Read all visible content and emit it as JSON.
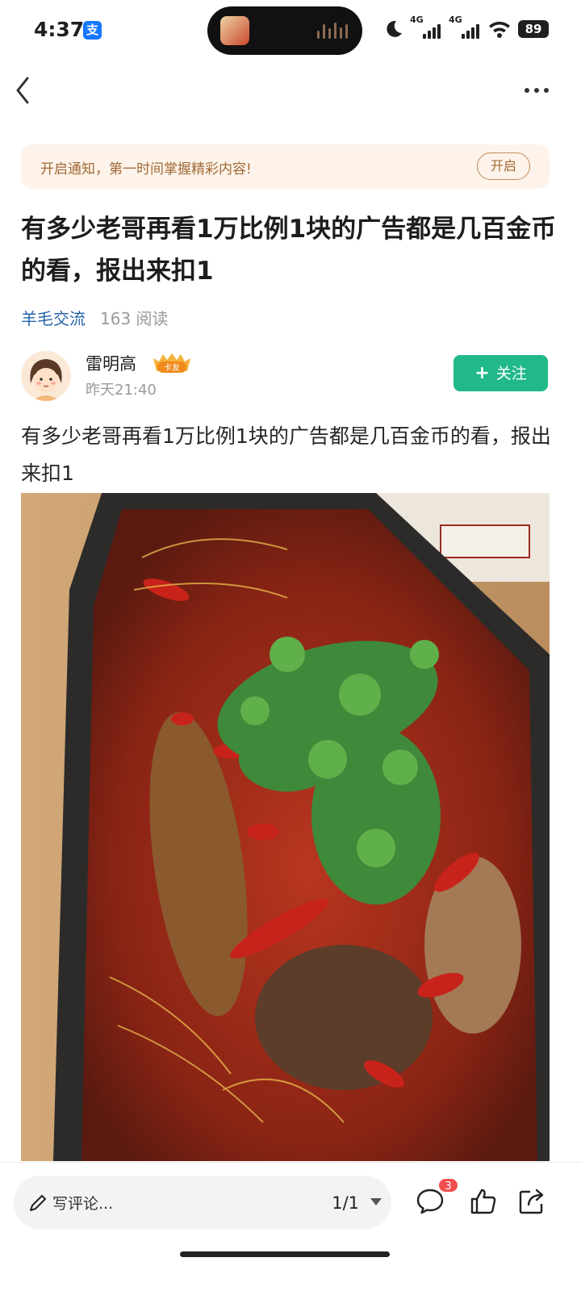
{
  "status_bar": {
    "time": "4:37",
    "alipay_icon": "支",
    "net1": "4G",
    "net2": "4G",
    "battery": "89"
  },
  "banner": {
    "text": "开启通知，第一时间掌握精彩内容!",
    "button": "开启"
  },
  "post": {
    "title": "有多少老哥再看1万比例1块的广告都是几百金币的看，报出来扣1",
    "topic": "羊毛交流",
    "reads": "163 阅读",
    "author": "雷明高",
    "author_badge": "卡友",
    "date": "昨天21:40",
    "follow_label": "关注",
    "body": "有多少老哥再看1万比例1块的广告都是几百金币的看，报出来扣1"
  },
  "bottom_bar": {
    "comment_placeholder": "写评论...",
    "page_indicator": "1/1",
    "comment_count": "3"
  },
  "colors": {
    "accent_green": "#22b98a",
    "topic_blue": "#2563a8",
    "banner_bg": "#fdf3ea",
    "banner_text": "#a26a37",
    "badge_red": "#f14d4d"
  },
  "icons": [
    "back-icon",
    "more-icon",
    "pen-icon",
    "comment-icon",
    "like-icon",
    "share-icon",
    "alipay-icon",
    "moon-icon",
    "wifi-icon"
  ]
}
